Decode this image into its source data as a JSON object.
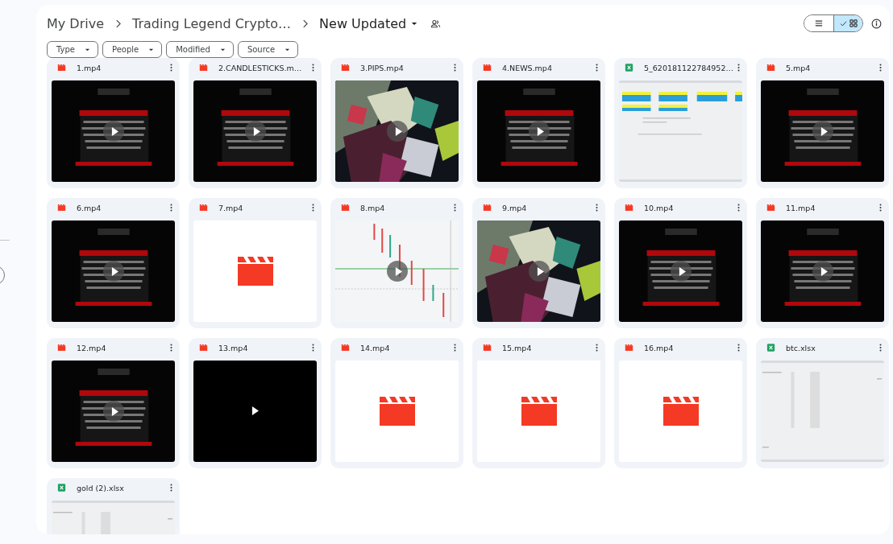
{
  "breadcrumbs": [
    {
      "label": "My Drive",
      "current": false
    },
    {
      "label": "Trading Legend Crypto…",
      "current": false
    },
    {
      "label": "New Updated",
      "current": true
    }
  ],
  "filters": [
    {
      "label": "Type"
    },
    {
      "label": "People"
    },
    {
      "label": "Modified"
    },
    {
      "label": "Source"
    }
  ],
  "view_toggle": [
    {
      "kind": "list",
      "selected": false
    },
    {
      "kind": "grid",
      "selected": true
    }
  ],
  "files": [
    {
      "name": "1.mp4",
      "kind": "video",
      "play_button": true
    },
    {
      "name": "2.CANDLESTICKS.m…",
      "kind": "video",
      "play_button": true
    },
    {
      "name": "3.PIPS.mp4",
      "kind": "video",
      "play_button": true
    },
    {
      "name": "4.NEWS.mp4",
      "kind": "video",
      "play_button": true
    },
    {
      "name": "5_620181122784952…",
      "kind": "sheet",
      "play_button": false
    },
    {
      "name": "5.mp4",
      "kind": "video",
      "play_button": true
    },
    {
      "name": "6.mp4",
      "kind": "video",
      "play_button": true
    },
    {
      "name": "7.mp4",
      "kind": "video",
      "thumbnail": {
        "kind": "placeholder"
      },
      "play_button": false
    },
    {
      "name": "8.mp4",
      "kind": "video",
      "play_button": true
    },
    {
      "name": "9.mp4",
      "kind": "video",
      "play_button": true
    },
    {
      "name": "10.mp4",
      "kind": "video",
      "play_button": true
    },
    {
      "name": "11.mp4",
      "kind": "video",
      "play_button": true
    },
    {
      "name": "12.mp4",
      "kind": "video",
      "play_button": true
    },
    {
      "name": "13.mp4",
      "kind": "video",
      "thumbnail": {
        "kind": "dark"
      },
      "play_button": true
    },
    {
      "name": "14.mp4",
      "kind": "video",
      "thumbnail": {
        "kind": "placeholder"
      },
      "play_button": false
    },
    {
      "name": "15.mp4",
      "kind": "video",
      "thumbnail": {
        "kind": "placeholder"
      },
      "play_button": false
    },
    {
      "name": "16.mp4",
      "kind": "video",
      "thumbnail": {
        "kind": "placeholder"
      },
      "play_button": false
    },
    {
      "name": "btc.xlsx",
      "kind": "sheet",
      "play_button": false
    },
    {
      "name": "gold (2).xlsx",
      "kind": "sheet",
      "play_button": false
    }
  ]
}
